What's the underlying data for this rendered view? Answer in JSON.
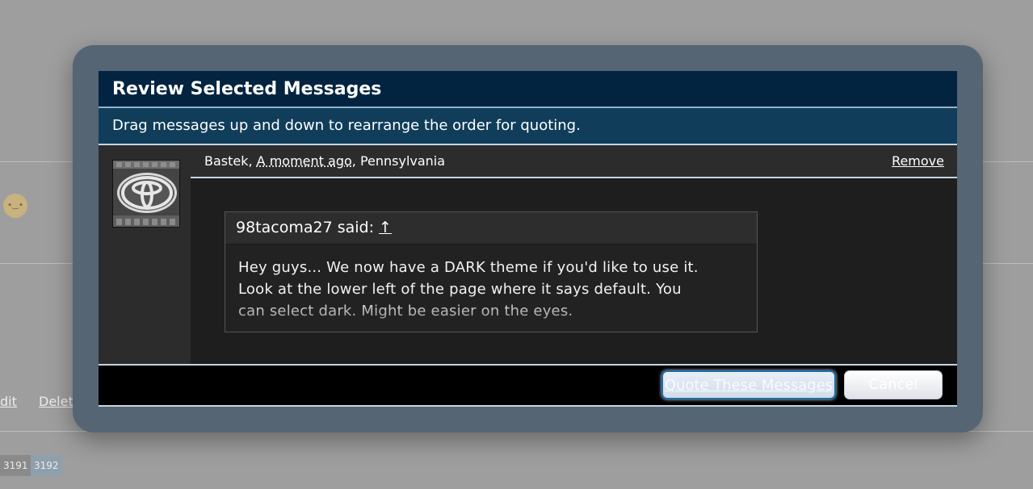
{
  "background": {
    "links": [
      "dit",
      "Delete"
    ],
    "pages": [
      "3191",
      "3192"
    ]
  },
  "dialog": {
    "title": "Review Selected Messages",
    "subtitle": "Drag messages up and down to rearrange the order for quoting.",
    "message": {
      "author": "Bastek",
      "date": "A moment ago",
      "location": "Pennsylvania",
      "remove_label": "Remove",
      "avatar_icon": "toyota-logo-icon",
      "quote": {
        "author_said": "98tacoma27 said:",
        "arrow": "↑",
        "lines": [
          "Hey guys... We now have a DARK theme if you'd like to use it.",
          "Look at the lower left of the page where it says default. You",
          "can select dark. Might be easier on the eyes."
        ]
      }
    },
    "buttons": {
      "quote": "Quote These Messages",
      "cancel": "Cancel"
    }
  },
  "colors": {
    "title_bar": "#022440",
    "subtitle_bar": "#103d5a",
    "frame": "#556574",
    "accent": "#1e6fa8"
  }
}
